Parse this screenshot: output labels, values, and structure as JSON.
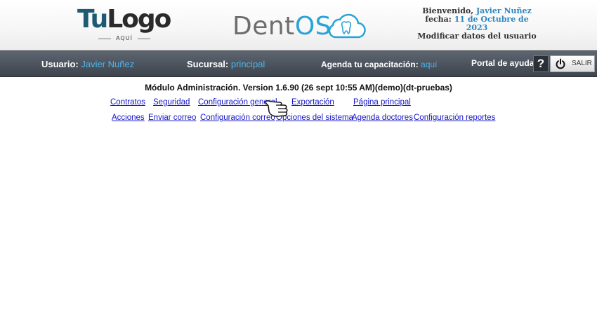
{
  "header": {
    "logo": {
      "part1": "Tu",
      "part2": "Logo",
      "sub": "AQUÍ"
    },
    "brand": {
      "part1": "Dent",
      "part2": "OS"
    },
    "welcome_label": "Bienvenido,",
    "user_name": "Javier Nuñez",
    "date_label": "fecha:",
    "date_value": "11 de Octubre de 2023",
    "modify_label": "Modificar datos del usuario"
  },
  "navbar": {
    "user_label": "Usuario:",
    "user_value": "Javier Nuñez",
    "branch_label": "Sucursal:",
    "branch_value": "principal",
    "training_label": "Agenda tu capacitación:",
    "training_link": "aquí",
    "help_label": "Portal de ayuda",
    "help_icon": "?",
    "logout_label": "SALIR"
  },
  "main": {
    "module_title": "Módulo Administración. Version 1.6.90 (26 sept 10:55 AM)(demo)(dt-pruebas)",
    "links_row1": [
      "Contratos",
      "Seguridad",
      "Configuración general",
      "Exportación",
      "Página principal"
    ],
    "links_row2": [
      "Acciones",
      "Enviar correo",
      "Configuración correo",
      "Opciones del sistema",
      "Agenda doctores",
      "Configuración reportes"
    ]
  },
  "colors": {
    "accent": "#2e86c1",
    "nav_value": "#4fb4ec",
    "link": "#1515c8",
    "navbar_bg": "#4a515a"
  }
}
